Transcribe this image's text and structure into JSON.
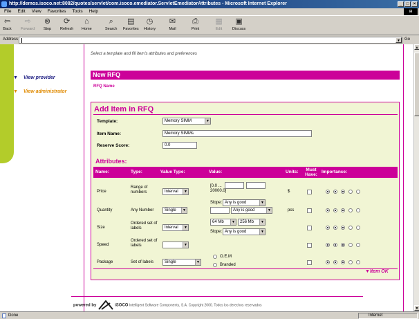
{
  "window": {
    "title": "http://demos.isoco.net:8082/quotes/servlet/com.isoco.emediator.ServletEmediatorAttributes - Microsoft Internet Explorer"
  },
  "menu": [
    "File",
    "Edit",
    "View",
    "Favorites",
    "Tools",
    "Help"
  ],
  "toolbar": {
    "back": "Back",
    "forward": "Forward",
    "stop": "Stop",
    "refresh": "Refresh",
    "home": "Home",
    "search": "Search",
    "favorites": "Favorites",
    "history": "History",
    "mail": "Mail",
    "print": "Print",
    "edit": "Edit",
    "discuss": "Discuss"
  },
  "address": {
    "label": "Address",
    "value": "",
    "go": "Go"
  },
  "page": {
    "subtitle": "Select a template and fill item's attributes and preferences",
    "nav": {
      "view_provider": "View provider",
      "view_administrator": "View administrator"
    },
    "header": "New RFQ",
    "rfq_name_label": "RFQ Name",
    "add_item_title": "Add Item in RFQ",
    "template_label": "Template:",
    "template_value": "Memory SIMM",
    "item_name_label": "Item Name:",
    "item_name_value": "Memory SIMMs",
    "reserve_label": "Reserve Score:",
    "reserve_value": "0.0",
    "attributes_title": "Attributes:",
    "columns": {
      "name": "Name:",
      "type": "Type:",
      "value_type": "Value Type:",
      "value": "Value:",
      "units": "Units:",
      "must_have": "Must Have:",
      "importance": "Importance:"
    },
    "rows": [
      {
        "name": "Price",
        "type": "Range of numbers",
        "value_type": "Interval",
        "range_label": "[0.0 ... 20000.0]",
        "slope_label": "Slope:",
        "slope_value": "Any is good",
        "units": "$"
      },
      {
        "name": "Quantity",
        "type": "Any Number",
        "value_type": "Single",
        "slope_value": "Any is good",
        "units": "pcs"
      },
      {
        "name": "Size",
        "type": "Ordered set of labels",
        "value_type": "Interval",
        "size_from": "64 Mb",
        "size_to": "256 Mb",
        "slope_label": "Slope:",
        "slope_value": "Any is good",
        "units": ""
      },
      {
        "name": "Speed",
        "type": "Ordered set of labels",
        "value_type": "",
        "units": ""
      },
      {
        "name": "Package",
        "type": "Set of labels",
        "value_type": "Single",
        "options": [
          "O.E.M",
          "Branded"
        ],
        "units": ""
      }
    ],
    "item_ok": "Item OK",
    "footer": {
      "powered_by": "powered by",
      "company": "iSOCO",
      "text": "Intelligent Software Components, S.A. Copyright 2000. Todos los derechos reservados"
    }
  },
  "status": {
    "left": "Done",
    "zone": "Internet"
  },
  "colors": {
    "accent": "#cc0099",
    "sidebar": "#b3cc2a",
    "panel": "#f1f5d4"
  }
}
